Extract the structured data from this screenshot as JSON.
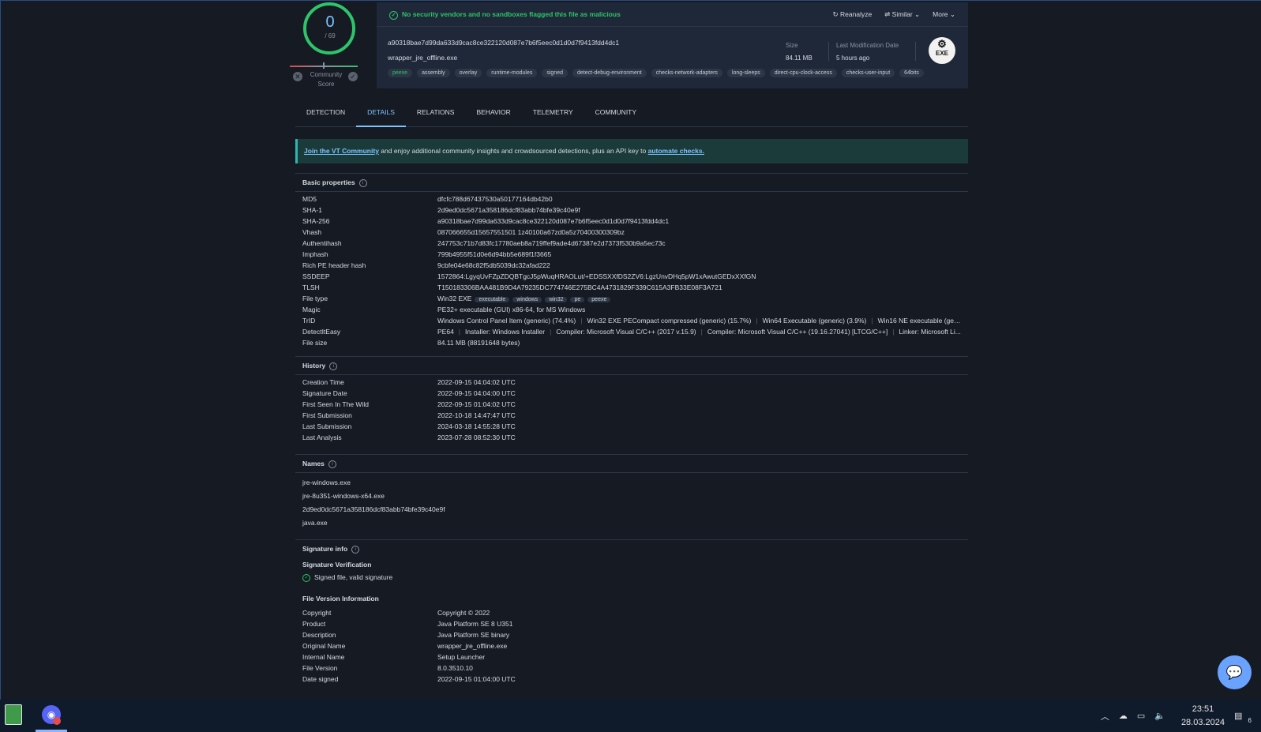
{
  "score": {
    "detections": "0",
    "total": "/ 69",
    "community_label": "Community Score"
  },
  "header": {
    "status_text": "No security vendors and no sandboxes flagged this file as malicious",
    "actions": {
      "reanalyze": "Reanalyze",
      "similar": "Similar",
      "more": "More"
    },
    "sha256": "a90318bae7d99da633d9cac8ce322120d087e7b6f5eec0d1d0d7f9413fdd4dc1",
    "filename": "wrapper_jre_offline.exe",
    "tags": [
      "peexe",
      "assembly",
      "overlay",
      "runtime-modules",
      "signed",
      "detect-debug-environment",
      "checks-network-adapters",
      "long-sleeps",
      "direct-cpu-clock-access",
      "checks-user-input",
      "64bits"
    ],
    "size_label": "Size",
    "size_value": "84.11 MB",
    "date_label": "Last Modification Date",
    "date_value": "5 hours ago",
    "filetype_icon_text": "EXE"
  },
  "tabs": [
    "DETECTION",
    "DETAILS",
    "RELATIONS",
    "BEHAVIOR",
    "TELEMETRY",
    "COMMUNITY"
  ],
  "active_tab": "DETAILS",
  "banner": {
    "link1": "Join the VT Community",
    "middle": " and enjoy additional community insights and crowdsourced detections, plus an API key to ",
    "link2": "automate checks."
  },
  "basic": {
    "title": "Basic properties",
    "rows": [
      [
        "MD5",
        "dfcfc788d67437530a50177164db42b0"
      ],
      [
        "SHA-1",
        "2d9ed0dc5671a358186dcf83abb74bfe39c40e9f"
      ],
      [
        "SHA-256",
        "a90318bae7d99da633d9cac8ce322120d087e7b6f5eec0d1d0d7f9413fdd4dc1"
      ],
      [
        "Vhash",
        "087066655d15657551501 1z40100a67zd0a5z70400300309bz"
      ],
      [
        "Authentihash",
        "247753c71b7d83fc17780aeb8a719ffef9ade4d67387e2d7373f530b9a5ec73c"
      ],
      [
        "Imphash",
        "799b4955f51d0e6d94bb5e689f1f3665"
      ],
      [
        "Rich PE header hash",
        "9cbfe04e68c82f5db5039dc32afad222"
      ],
      [
        "SSDEEP",
        "1572864:LgyqUvFZpZDQBTgcJ5pWuqHRAOLut/+EDSSXXfDS2ZV6:LgzUnvDHq5pW1xAwutGEDxXXfGN"
      ],
      [
        "TLSH",
        "T150183306BAA481B9D4A79235DC774746E275BC4A4731829F339C615A3FB33E08F3A721"
      ]
    ],
    "filetype": {
      "key": "File type",
      "value": "Win32 EXE",
      "pills": [
        "executable",
        "windows",
        "win32",
        "pe",
        "peexe"
      ]
    },
    "magic": {
      "key": "Magic",
      "value": "PE32+ executable (GUI) x86-64, for MS Windows"
    },
    "trid": {
      "key": "TrID",
      "items": [
        "Windows Control Panel Item (generic) (74.4%)",
        "Win32 EXE PECompact compressed (generic) (15.7%)",
        "Win64 Executable (generic) (3.9%)",
        "Win16 NE executable (gen..."
      ]
    },
    "die": {
      "key": "DetectItEasy",
      "items": [
        "PE64",
        "Installer: Windows Installer",
        "Compiler: Microsoft Visual C/C++ (2017 v.15.9)",
        "Compiler: Microsoft Visual C/C++ (19.16.27041) [LTCG/C++]",
        "Linker: Microsoft Li..."
      ]
    },
    "filesize": {
      "key": "File size",
      "value": "84.11 MB (88191648 bytes)"
    }
  },
  "history": {
    "title": "History",
    "rows": [
      [
        "Creation Time",
        "2022-09-15 04:04:02 UTC"
      ],
      [
        "Signature Date",
        "2022-09-15 04:04:00 UTC"
      ],
      [
        "First Seen In The Wild",
        "2022-09-15 01:04:02 UTC"
      ],
      [
        "First Submission",
        "2022-10-18 14:47:47 UTC"
      ],
      [
        "Last Submission",
        "2024-03-18 14:55:28 UTC"
      ],
      [
        "Last Analysis",
        "2023-07-28 08:52:30 UTC"
      ]
    ]
  },
  "names": {
    "title": "Names",
    "items": [
      "jre-windows.exe",
      "jre-8u351-windows-x64.exe",
      "2d9ed0dc5671a358186dcf83abb74bfe39c40e9f",
      "java.exe"
    ]
  },
  "signature": {
    "title": "Signature info",
    "verification_title": "Signature Verification",
    "verification_value": "Signed file, valid signature",
    "fvi_title": "File Version Information",
    "rows": [
      [
        "Copyright",
        "Copyright © 2022"
      ],
      [
        "Product",
        "Java Platform SE 8 U351"
      ],
      [
        "Description",
        "Java Platform SE binary"
      ],
      [
        "Original Name",
        "wrapper_jre_offline.exe"
      ],
      [
        "Internal Name",
        "Setup Launcher"
      ],
      [
        "File Version",
        "8.0.3510.10"
      ],
      [
        "Date signed",
        "2022-09-15 01:04:00 UTC"
      ]
    ]
  },
  "taskbar": {
    "time": "23:51",
    "date": "28.03.2024",
    "notif_count": "6"
  },
  "colors": {
    "accent": "#7cc3ff",
    "clean": "#2ec46b",
    "background": "#161a22",
    "panel": "#1f2838"
  }
}
